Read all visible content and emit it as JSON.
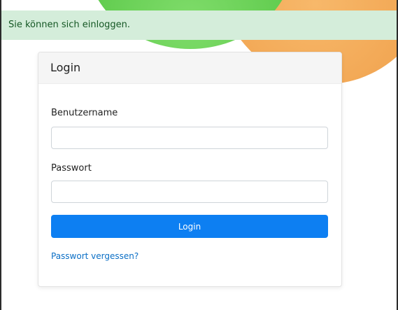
{
  "alert": {
    "message": "Sie können sich einloggen."
  },
  "login_card": {
    "title": "Login",
    "username_label": "Benutzername",
    "username_value": "",
    "password_label": "Passwort",
    "password_value": "",
    "submit_label": "Login",
    "forgot_link": "Passwort vergessen?"
  },
  "colors": {
    "alert_bg": "#d4edda",
    "alert_text": "#155724",
    "primary_button": "#0d7ff2",
    "link": "#0b6fc6",
    "decor_green": "#5cc94a",
    "decor_orange": "#f0a04b"
  }
}
